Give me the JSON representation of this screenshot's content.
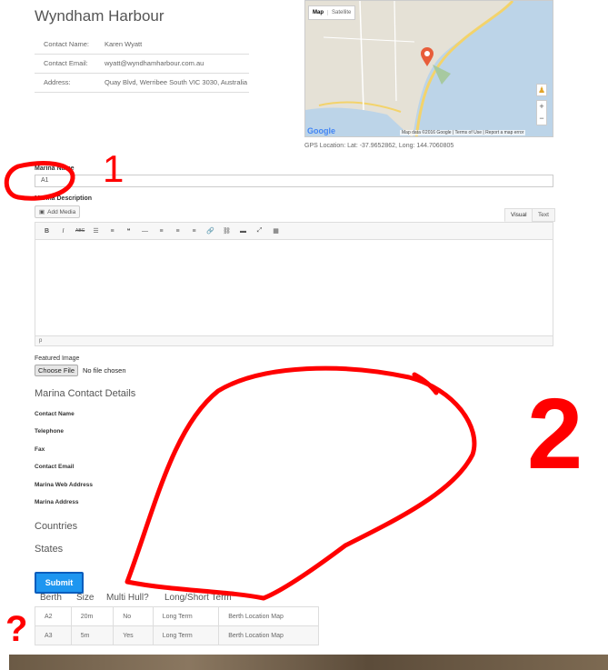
{
  "header": {
    "title": "Wyndham Harbour"
  },
  "contact": [
    {
      "label": "Contact Name:",
      "value": "Karen Wyatt"
    },
    {
      "label": "Contact Email:",
      "value": "wyatt@wyndhamharbour.com.au"
    },
    {
      "label": "Address:",
      "value": "Quay Blvd, Werribee South VIC 3030, Australia"
    }
  ],
  "map": {
    "type_map": "Map",
    "type_satellite": "Satellite",
    "zoom_in": "+",
    "zoom_out": "−",
    "logo": "Google",
    "attribution": "Map data ©2016 Google | Terms of Use | Report a map error",
    "gps": "GPS Location: Lat: -37.9652862, Long: 144.7060805",
    "colors": {
      "water": "#bcd4e8",
      "land": "#e5e1d6",
      "marker": "#e85d3a"
    }
  },
  "form": {
    "name_label": "Marina Name",
    "name_value": "A1",
    "description_label": "Marina Description",
    "add_media": "Add Media",
    "tab_visual": "Visual",
    "tab_text": "Text",
    "toolbar": [
      "B",
      "I",
      "ABC",
      "☰",
      "≡",
      "❝",
      "—",
      "≡",
      "≡",
      "≡",
      "🔗",
      "⛓",
      "▬",
      "⤢",
      "▦"
    ],
    "path": "p",
    "featured_label": "Featured Image",
    "choose_file": "Choose File",
    "file_status": "No file chosen"
  },
  "contact_details": {
    "heading": "Marina Contact Details",
    "fields": [
      "Contact Name",
      "Telephone",
      "Fax",
      "Contact Email",
      "Marina Web Address",
      "Marina Address"
    ]
  },
  "countries_heading": "Countries",
  "states_heading": "States",
  "submit_label": "Submit",
  "berths": {
    "headers": [
      "Berth",
      "Size",
      "Multi Hull?",
      "Long/Short Term"
    ],
    "rows": [
      [
        "A2",
        "20m",
        "No",
        "Long Term",
        "Berth Location Map"
      ],
      [
        "A3",
        "5m",
        "Yes",
        "Long Term",
        "Berth Location Map"
      ]
    ]
  },
  "annotations": {
    "one": "1",
    "two": "2",
    "question": "?",
    "color": "#ff0000"
  }
}
